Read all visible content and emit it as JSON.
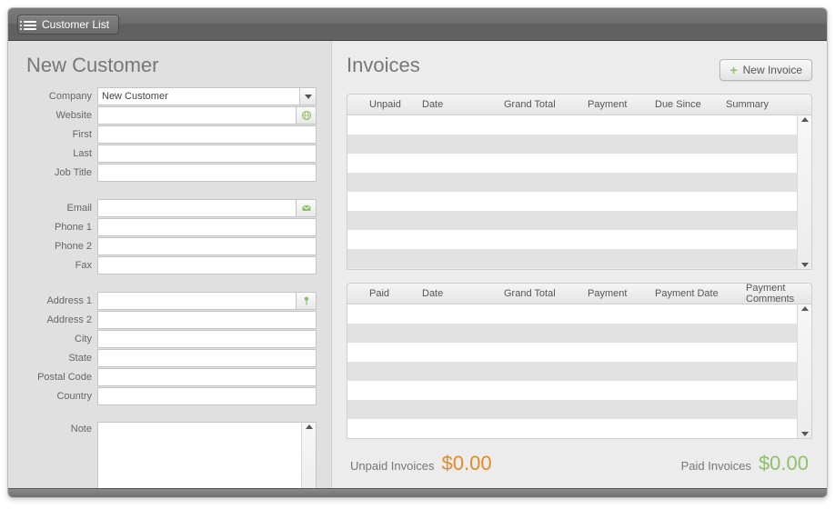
{
  "topbar": {
    "customer_list": "Customer List"
  },
  "left": {
    "heading": "New Customer",
    "fields": {
      "company_label": "Company",
      "company_value": "New Customer",
      "website_label": "Website",
      "website_value": "",
      "first_label": "First",
      "first_value": "",
      "last_label": "Last",
      "last_value": "",
      "jobtitle_label": "Job Title",
      "jobtitle_value": "",
      "email_label": "Email",
      "email_value": "",
      "phone1_label": "Phone 1",
      "phone1_value": "",
      "phone2_label": "Phone 2",
      "phone2_value": "",
      "fax_label": "Fax",
      "fax_value": "",
      "address1_label": "Address 1",
      "address1_value": "",
      "address2_label": "Address 2",
      "address2_value": "",
      "city_label": "City",
      "city_value": "",
      "state_label": "State",
      "state_value": "",
      "postal_label": "Postal Code",
      "postal_value": "",
      "country_label": "Country",
      "country_value": "",
      "note_label": "Note",
      "note_value": ""
    }
  },
  "right": {
    "heading": "Invoices",
    "new_invoice": "New Invoice",
    "unpaid_table": {
      "cols": {
        "status": "Unpaid",
        "date": "Date",
        "total": "Grand Total",
        "payment": "Payment",
        "due": "Due Since",
        "summary": "Summary"
      }
    },
    "paid_table": {
      "cols": {
        "status": "Paid",
        "date": "Date",
        "total": "Grand Total",
        "payment": "Payment",
        "paydate": "Payment Date",
        "paycomments": "Payment Comments"
      }
    },
    "totals": {
      "unpaid_label": "Unpaid Invoices",
      "unpaid_value": "$0.00",
      "paid_label": "Paid Invoices",
      "paid_value": "$0.00"
    }
  }
}
